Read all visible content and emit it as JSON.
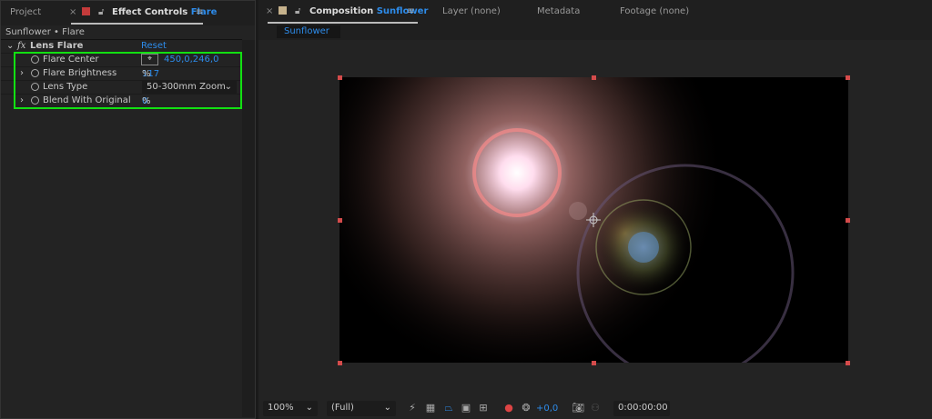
{
  "left_panel": {
    "tab_project": "Project",
    "tab_effect_controls": "Effect Controls",
    "tab_effect_layer": "Flare",
    "breadcrumb": "Sunflower • Flare",
    "effect": {
      "fx": "fx",
      "name": "Lens Flare",
      "reset": "Reset",
      "params": [
        {
          "label": "Flare Center",
          "value": "450,0,246,0"
        },
        {
          "label": "Flare Brightness",
          "value": "117",
          "unit": "%"
        },
        {
          "label": "Lens Type",
          "value": "50-300mm Zoom"
        },
        {
          "label": "Blend With Original",
          "value": "0",
          "unit": "%"
        }
      ]
    }
  },
  "right_panel": {
    "tab_composition": "Composition",
    "tab_comp_name": "Sunflower",
    "tab_layer": "Layer (none)",
    "tab_metadata": "Metadata",
    "tab_footage": "Footage (none)",
    "comp_chip": "Sunflower",
    "toolbar": {
      "zoom": "100%",
      "resolution": "(Full)",
      "exposure": "+0,0",
      "timecode": "0:00:00:00"
    }
  }
}
